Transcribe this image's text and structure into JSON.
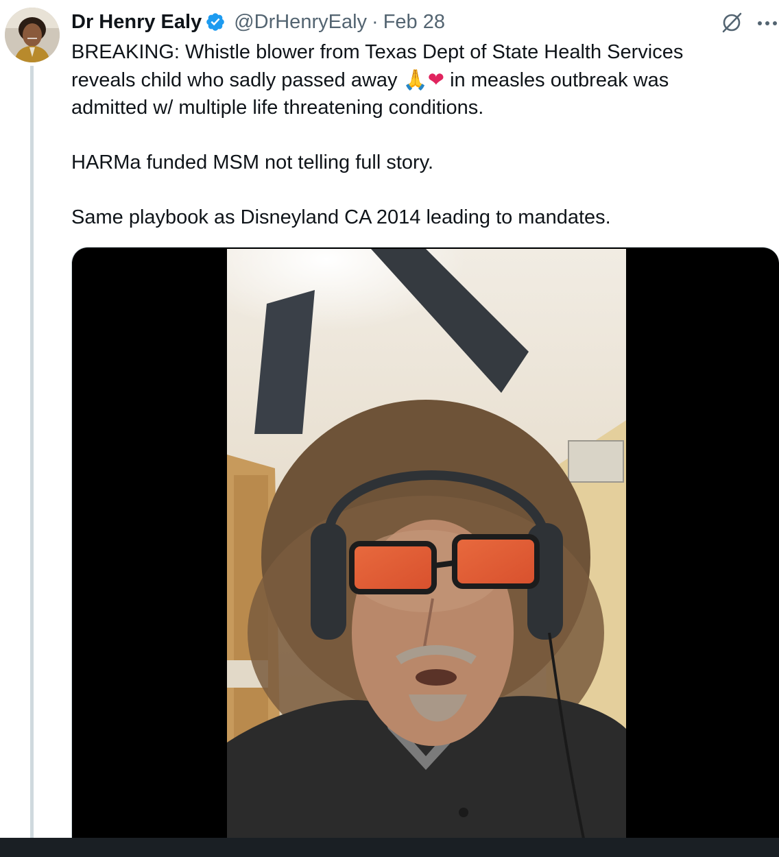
{
  "tweet": {
    "author": {
      "display_name": "Dr Henry Ealy",
      "handle": "@DrHenryEaly",
      "verified": true,
      "avatar_icon": "profile-avatar"
    },
    "separator": "·",
    "date": "Feb 28",
    "text": {
      "line1": "BREAKING: Whistle blower from Texas Dept of State Health Services",
      "line2_before_emoji": "reveals child who sadly passed away ",
      "emoji_pray": "🙏",
      "emoji_heart": "❤",
      "line2_after_emoji": " in measles outbreak was",
      "line3": "admitted w/ multiple life threatening conditions.",
      "paragraph2": "HARMa funded MSM not telling full story.",
      "paragraph3": "Same playbook as Disneyland CA 2014 leading to mandates."
    },
    "media": {
      "type": "video",
      "background_color": "#000000"
    }
  },
  "icons": {
    "verified": "verified-badge-icon",
    "grok": "grok-icon",
    "more": "more-options-icon"
  },
  "colors": {
    "text_primary": "#0f1419",
    "text_secondary": "#536471",
    "verified_blue": "#1d9bf0",
    "thread_line": "#cfd9de"
  }
}
